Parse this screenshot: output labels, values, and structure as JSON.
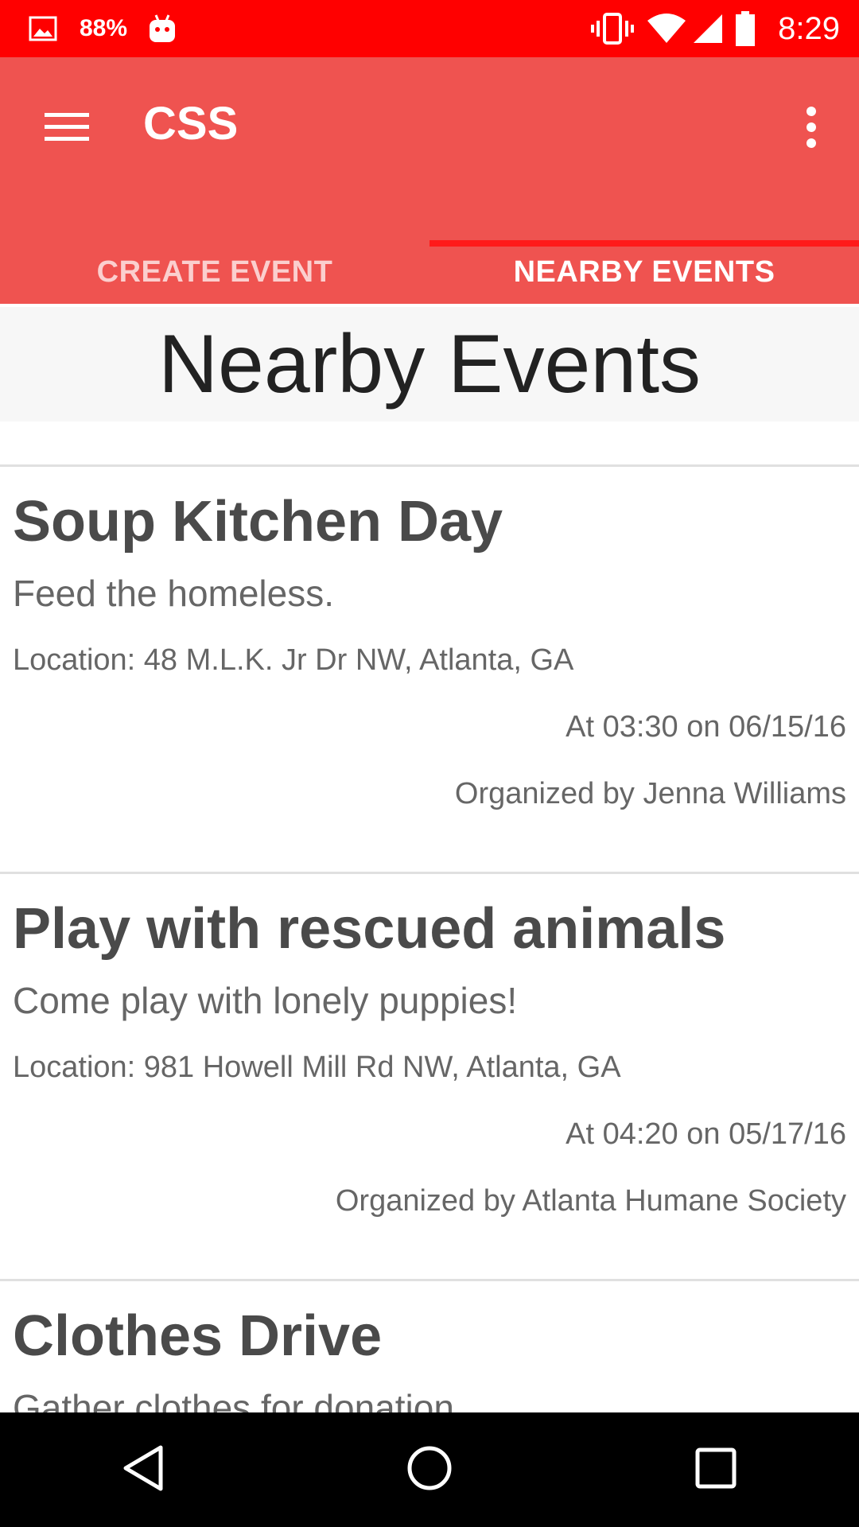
{
  "status_bar": {
    "battery_percent": "88%",
    "time": "8:29",
    "icons": [
      "image-icon",
      "android-icon",
      "vibrate-icon",
      "wifi-icon",
      "signal-icon",
      "battery-icon"
    ]
  },
  "app_bar": {
    "title": "CSS",
    "menu_icon": "hamburger-icon",
    "more_icon": "more-vert-icon",
    "color": "#ef5350"
  },
  "tabs": [
    {
      "label": "CREATE EVENT",
      "active": false
    },
    {
      "label": "NEARBY EVENTS",
      "active": true
    }
  ],
  "page": {
    "title": "Nearby Events"
  },
  "events": [
    {
      "title": "Soup Kitchen Day",
      "description": "Feed the homeless.",
      "location": "Location: 48 M.L.K. Jr Dr NW, Atlanta, GA",
      "time": "At 03:30 on 06/15/16",
      "organizer": "Organized by Jenna Williams"
    },
    {
      "title": "Play with rescued animals",
      "description": "Come play with lonely puppies!",
      "location": "Location: 981 Howell Mill Rd NW, Atlanta, GA",
      "time": "At 04:20 on 05/17/16",
      "organizer": "Organized by Atlanta Humane Society"
    },
    {
      "title": "Clothes Drive",
      "description": "Gather clothes for donation"
    }
  ],
  "nav_bar": {
    "icons": [
      "back-icon",
      "home-icon",
      "recents-icon"
    ]
  },
  "colors": {
    "status_bar": "#ff0000",
    "accent": "#ef5350",
    "indicator": "#ff1a1a"
  }
}
